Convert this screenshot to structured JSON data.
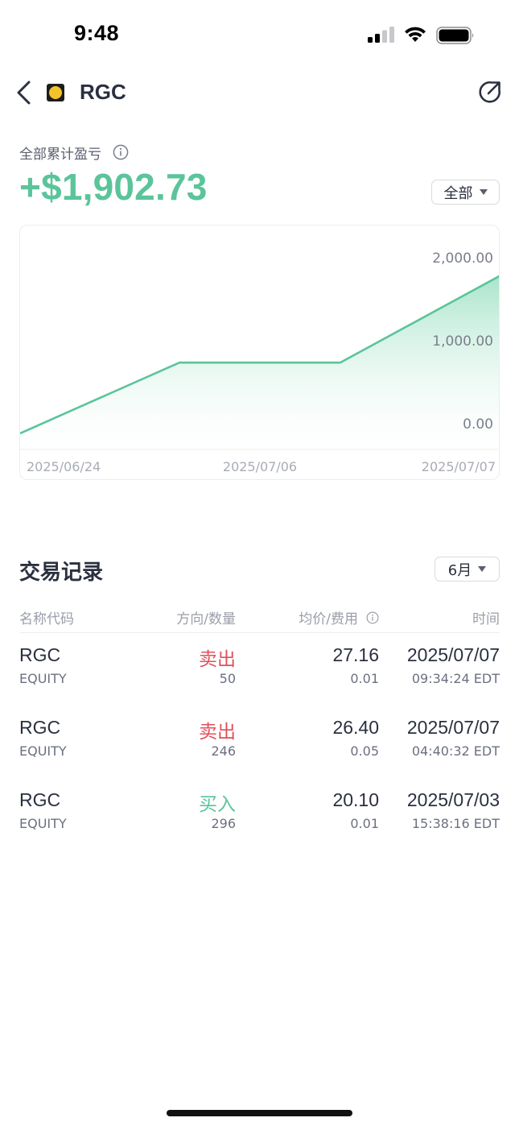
{
  "status_bar": {
    "time": "9:48"
  },
  "nav": {
    "title": "RGC"
  },
  "pnl": {
    "label": "全部累计盈亏",
    "value": "+$1,902.73",
    "range_label": "全部"
  },
  "chart_data": {
    "type": "area",
    "x": [
      "2025/06/24",
      "2025/07/03",
      "2025/07/06",
      "2025/07/07"
    ],
    "y": [
      0,
      853,
      853,
      1902.73
    ],
    "x_tick_labels": [
      "2025/06/24",
      "2025/07/06",
      "2025/07/07"
    ],
    "y_tick_labels": [
      "2,000.00",
      "1,000.00",
      "0.00"
    ],
    "y_ticks": [
      2000,
      1000,
      0
    ],
    "ylim": [
      0,
      2000
    ],
    "grid": false,
    "legend": "none",
    "colors": {
      "line": "#5bc49a",
      "fill_top": "#a9e4cb",
      "fill_bottom": "#ffffff"
    }
  },
  "trades": {
    "title": "交易记录",
    "month_label": "6月",
    "headers": {
      "name": "名称代码",
      "direction": "方向/数量",
      "price": "均价/费用",
      "time": "时间"
    },
    "rows": [
      {
        "symbol": "RGC",
        "type": "EQUITY",
        "side": "卖出",
        "side_color": "#e0505a",
        "qty": "50",
        "price": "27.16",
        "fee": "0.01",
        "date": "2025/07/07",
        "time": "09:34:24 EDT"
      },
      {
        "symbol": "RGC",
        "type": "EQUITY",
        "side": "卖出",
        "side_color": "#e0505a",
        "qty": "246",
        "price": "26.40",
        "fee": "0.05",
        "date": "2025/07/07",
        "time": "04:40:32 EDT"
      },
      {
        "symbol": "RGC",
        "type": "EQUITY",
        "side": "买入",
        "side_color": "#5bc49a",
        "qty": "296",
        "price": "20.10",
        "fee": "0.01",
        "date": "2025/07/03",
        "time": "15:38:16 EDT"
      }
    ]
  },
  "colors": {
    "accent_green": "#5bc49a",
    "sell_red": "#e0505a",
    "text_primary": "#2b3040"
  }
}
